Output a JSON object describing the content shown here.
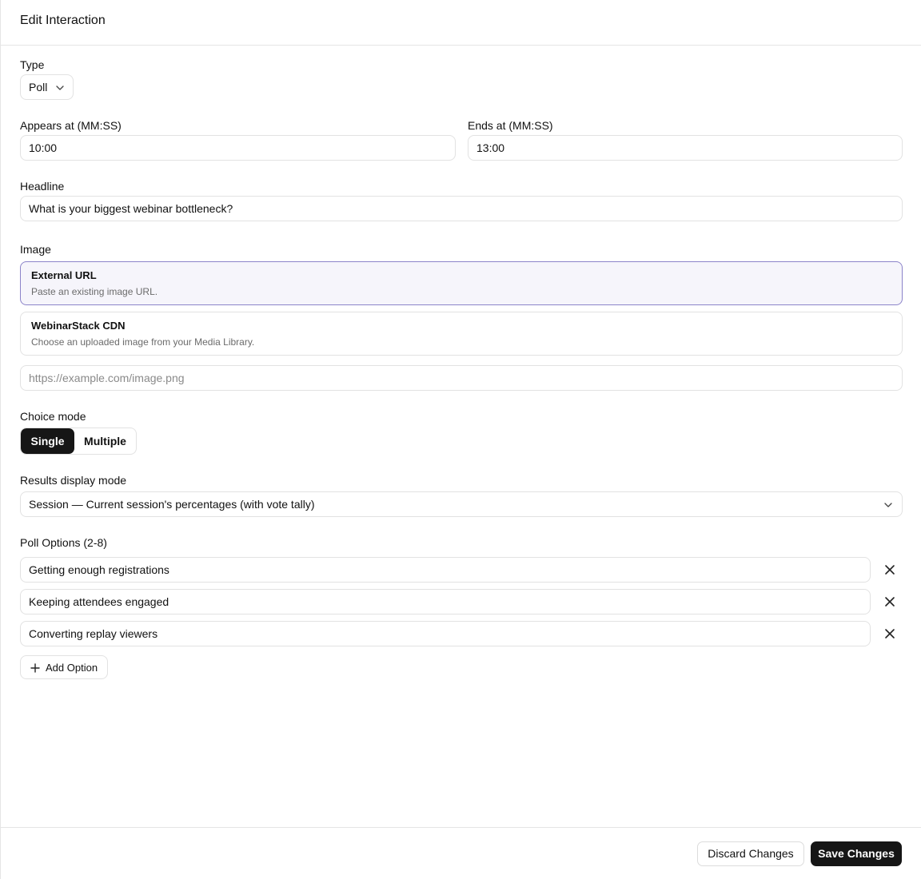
{
  "header": {
    "title": "Edit Interaction"
  },
  "type": {
    "label": "Type",
    "value": "Poll"
  },
  "appears": {
    "label": "Appears at (MM:SS)",
    "value": "10:00"
  },
  "ends": {
    "label": "Ends at (MM:SS)",
    "value": "13:00"
  },
  "headline": {
    "label": "Headline",
    "value": "What is your biggest webinar bottleneck?"
  },
  "image": {
    "label": "Image",
    "options": [
      {
        "title": "External URL",
        "description": "Paste an existing image URL.",
        "selected": true
      },
      {
        "title": "WebinarStack CDN",
        "description": "Choose an uploaded image from your Media Library.",
        "selected": false
      }
    ],
    "url_placeholder": "https://example.com/image.png"
  },
  "choice_mode": {
    "label": "Choice mode",
    "options": [
      "Single",
      "Multiple"
    ],
    "selected": "Single"
  },
  "results": {
    "label": "Results display mode",
    "value": "Session — Current session's percentages (with vote tally)"
  },
  "poll_options": {
    "label": "Poll Options (2-8)",
    "items": [
      "Getting enough registrations",
      "Keeping attendees engaged",
      "Converting replay viewers"
    ],
    "add_label": "Add Option"
  },
  "footer": {
    "discard_label": "Discard Changes",
    "save_label": "Save Changes"
  },
  "icons": {
    "chevron": "chevron-down-icon",
    "remove": "close-icon",
    "add": "plus-icon"
  },
  "colors": {
    "primary": "#161616",
    "selected_border": "#8b83c9",
    "selected_bg": "#f6f5fb"
  }
}
